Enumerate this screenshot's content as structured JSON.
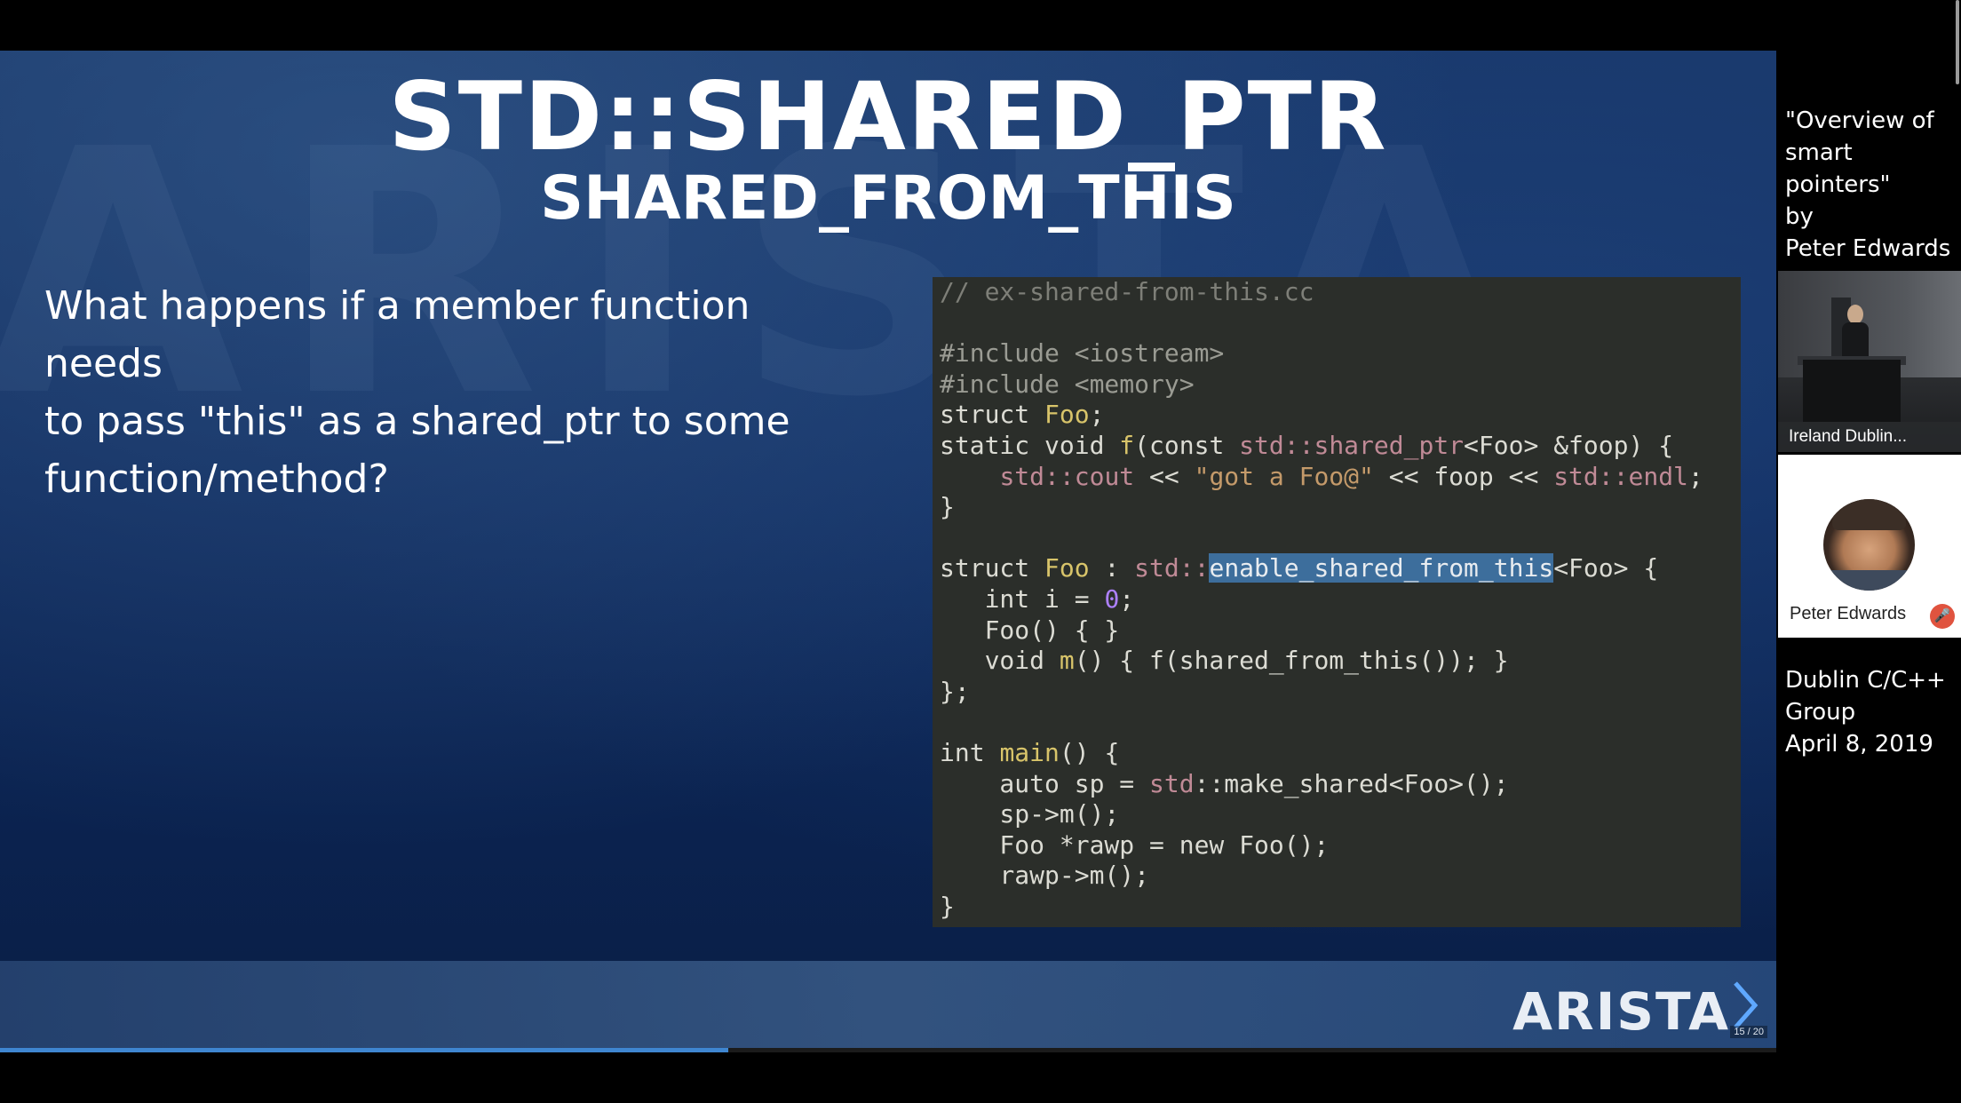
{
  "slide": {
    "title": "STD::SHARED_PTR",
    "subtitle": "SHARED_FROM_THIS",
    "question_lines": [
      "What happens if a member function needs",
      "to pass \"this\" as a shared_ptr to some",
      "function/method?"
    ],
    "watermark": "ARISTA",
    "logo": "ARISTA",
    "page_indicator": "15 / 20"
  },
  "code": {
    "lines": [
      [
        [
          "cm",
          "// ex-shared-from-this.cc"
        ]
      ],
      [],
      [
        [
          "pp",
          "#include <iostream>"
        ]
      ],
      [
        [
          "pp",
          "#include <memory>"
        ]
      ],
      [
        [
          "kw",
          "struct "
        ],
        [
          "fn",
          "Foo"
        ],
        [
          "kw",
          ";"
        ]
      ],
      [
        [
          "kw",
          "static void "
        ],
        [
          "fn",
          "f"
        ],
        [
          "kw",
          "(const "
        ],
        [
          "ns",
          "std::shared_ptr"
        ],
        [
          "kw",
          "<Foo> &foop) {"
        ]
      ],
      [
        [
          "kw",
          "    "
        ],
        [
          "ns",
          "std::cout"
        ],
        [
          "kw",
          " << "
        ],
        [
          "st",
          "\"got a Foo@\""
        ],
        [
          "kw",
          " << foop << "
        ],
        [
          "ns",
          "std::endl"
        ],
        [
          "kw",
          ";"
        ]
      ],
      [
        [
          "kw",
          "}"
        ]
      ],
      [],
      [
        [
          "kw",
          "struct "
        ],
        [
          "fn",
          "Foo"
        ],
        [
          "kw",
          " : "
        ],
        [
          "ns",
          "std::"
        ],
        [
          "hl",
          "enable_shared_from_this"
        ],
        [
          "kw",
          "<Foo> {"
        ]
      ],
      [
        [
          "kw",
          "   int i = "
        ],
        [
          "nm",
          "0"
        ],
        [
          "kw",
          ";"
        ]
      ],
      [
        [
          "kw",
          "   Foo() { }"
        ]
      ],
      [
        [
          "kw",
          "   void "
        ],
        [
          "fn",
          "m"
        ],
        [
          "kw",
          "() { f(shared_from_this()); }"
        ]
      ],
      [
        [
          "kw",
          "};"
        ]
      ],
      [],
      [
        [
          "kw",
          "int "
        ],
        [
          "fn",
          "main"
        ],
        [
          "kw",
          "() {"
        ]
      ],
      [
        [
          "kw",
          "    auto sp = "
        ],
        [
          "ns",
          "std"
        ],
        [
          "kw",
          "::make_shared<Foo>();"
        ]
      ],
      [
        [
          "kw",
          "    sp->m();"
        ]
      ],
      [
        [
          "kw",
          "    Foo *rawp = new Foo();"
        ]
      ],
      [
        [
          "kw",
          "    rawp->m();"
        ]
      ],
      [
        [
          "kw",
          "}"
        ]
      ]
    ]
  },
  "sidebar": {
    "talk_title_lines": [
      "\"Overview of",
      "smart pointers\"",
      "by",
      "Peter Edwards"
    ],
    "camera_label": "Ireland Dublin...",
    "speaker_label": "Peter Edwards",
    "group_info_lines": [
      "Dublin C/C++",
      "Group",
      "April 8, 2019"
    ]
  },
  "progress": {
    "fraction": 0.41
  },
  "colors": {
    "progress": "#3f86d0",
    "highlight": "#3d6e9c",
    "code_bg": "#2b2e2a"
  }
}
